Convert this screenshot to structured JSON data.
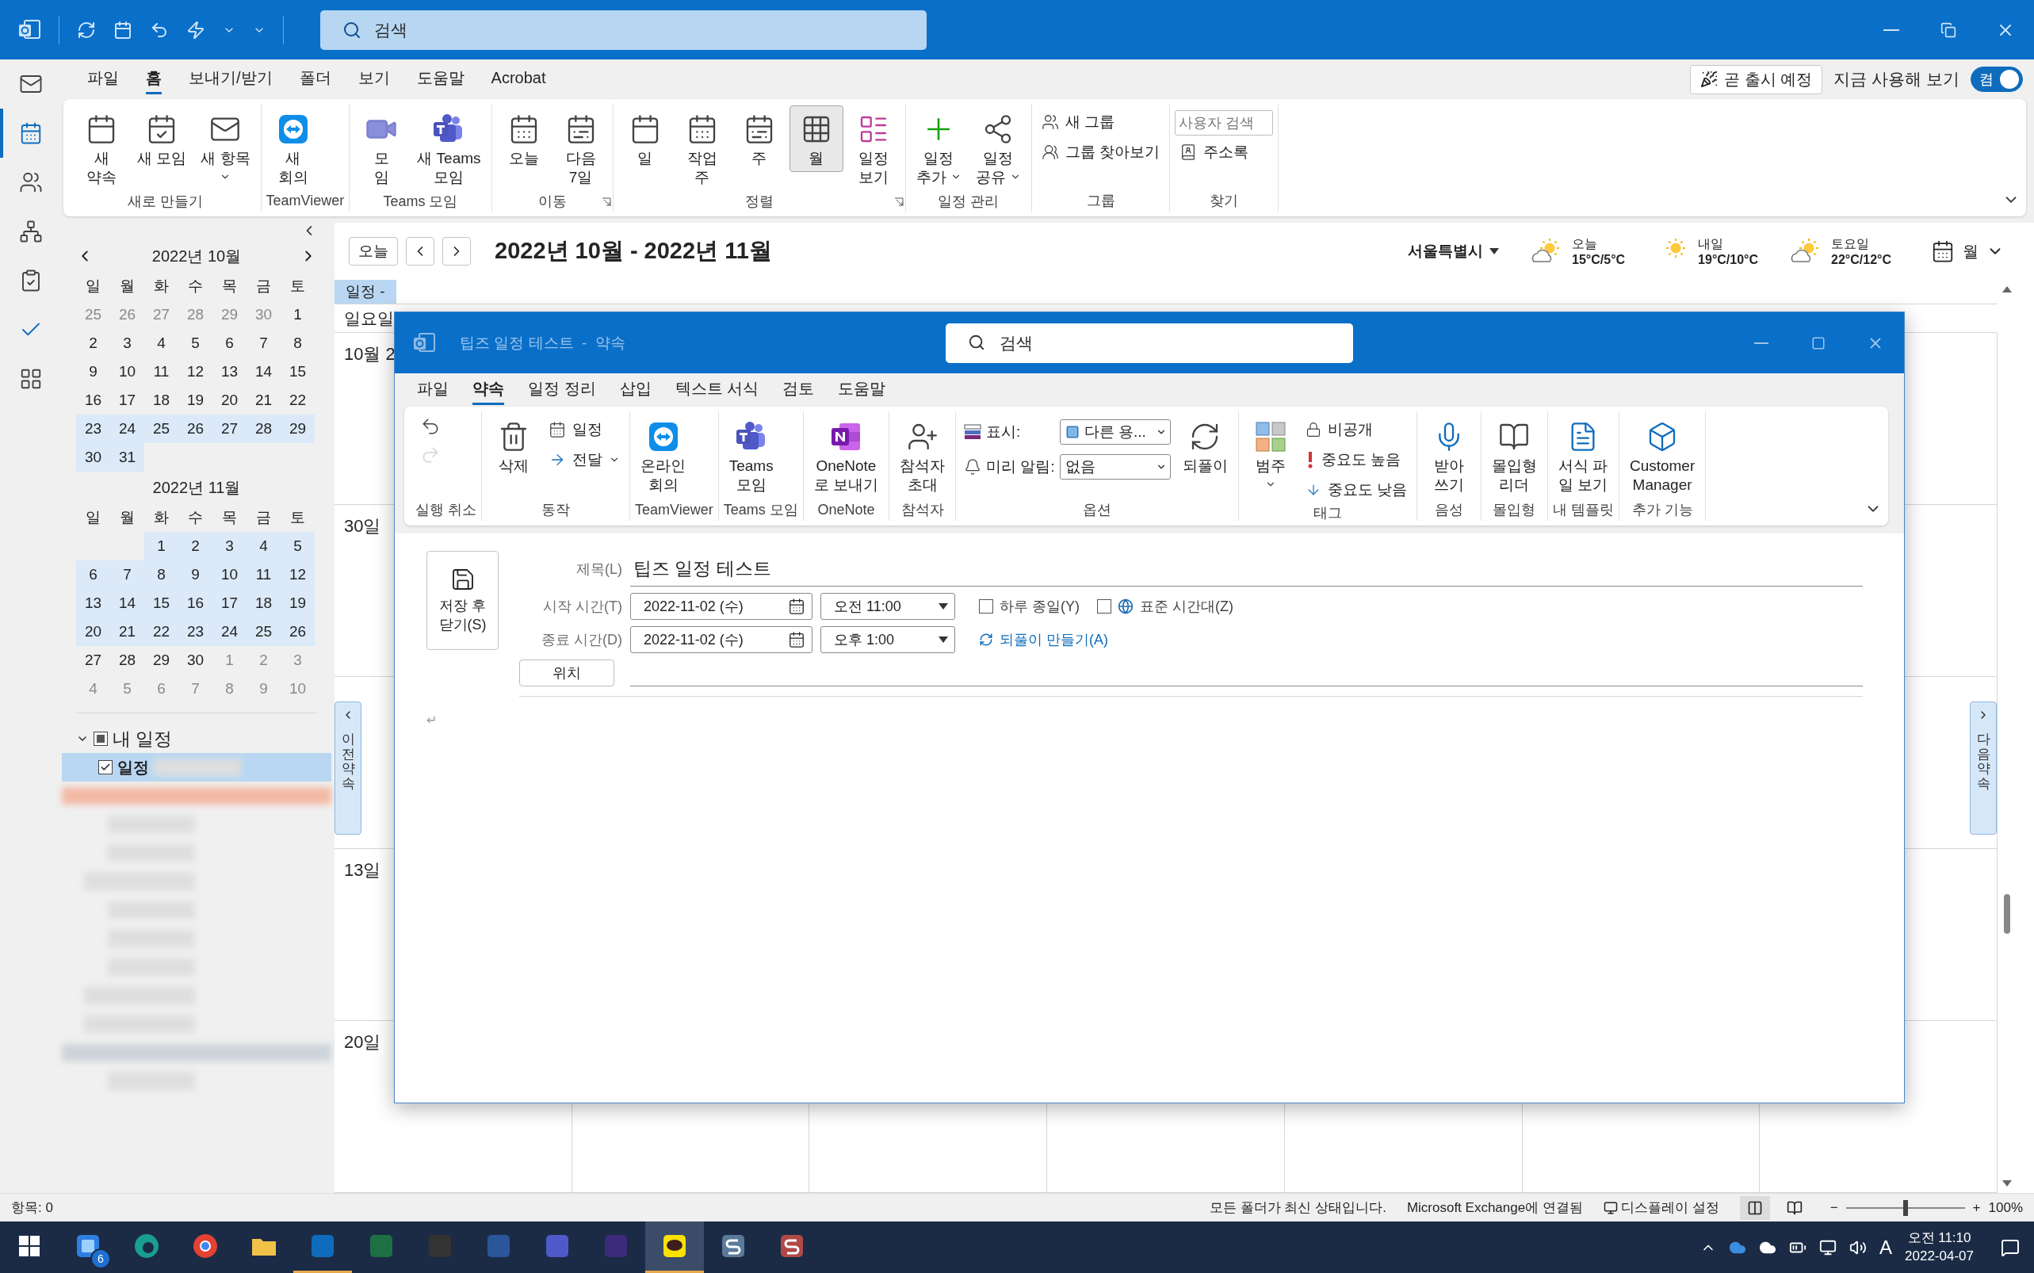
{
  "titlebar": {
    "search": {
      "placeholder": "검색"
    }
  },
  "menu": {
    "tabs": [
      {
        "label": "파일",
        "selected": false
      },
      {
        "label": "홈",
        "selected": true
      },
      {
        "label": "보내기/받기",
        "selected": false
      },
      {
        "label": "폴더",
        "selected": false
      },
      {
        "label": "보기",
        "selected": false
      },
      {
        "label": "도움말",
        "selected": false
      },
      {
        "label": "Acrobat",
        "selected": false
      }
    ],
    "coming_soon": "곧 출시 예정",
    "try_now": "지금 사용해 보기",
    "toggle": {
      "label": "켬",
      "on": true
    }
  },
  "nav": [
    {
      "selected": false
    },
    {
      "selected": true
    },
    {
      "selected": false
    },
    {
      "selected": false
    },
    {
      "selected": false
    },
    {
      "selected": false
    },
    {
      "selected": false
    }
  ],
  "ribbon": {
    "groups": [
      {
        "name": "새로 만들기",
        "items": [
          {
            "kind": "large",
            "label": "새\n약속"
          },
          {
            "kind": "large",
            "label": "새 모임"
          },
          {
            "kind": "large",
            "label": "새 항목",
            "menu": true
          }
        ]
      },
      {
        "name": "TeamViewer",
        "items": [
          {
            "kind": "large",
            "label": "새\n회의"
          }
        ]
      },
      {
        "name": "Teams 모임",
        "items": [
          {
            "kind": "large",
            "label": "모\n임"
          },
          {
            "kind": "large",
            "label": "새 Teams\n모임"
          }
        ]
      },
      {
        "name": "이동",
        "launcher": true,
        "items": [
          {
            "kind": "large",
            "label": "오늘"
          },
          {
            "kind": "large",
            "label": "다음\n7일"
          }
        ]
      },
      {
        "name": "정렬",
        "launcher": true,
        "items": [
          {
            "kind": "large",
            "label": "일",
            "selected": false
          },
          {
            "kind": "large",
            "label": "작업\n주",
            "selected": false
          },
          {
            "kind": "large",
            "label": "주",
            "selected": false
          },
          {
            "kind": "large",
            "label": "월",
            "selected": true
          },
          {
            "kind": "large",
            "label": "일정\n보기",
            "selected": false
          }
        ]
      },
      {
        "name": "일정 관리",
        "items": [
          {
            "kind": "large",
            "label": "일정\n추가",
            "menu": true
          },
          {
            "kind": "large",
            "label": "일정\n공유",
            "menu": true
          }
        ]
      },
      {
        "name": "그룹",
        "items": [
          {
            "kind": "stack",
            "entries": [
              {
                "kind": "small",
                "label": "새 그룹"
              },
              {
                "kind": "small",
                "label": "그룹 찾아보기"
              }
            ]
          }
        ]
      },
      {
        "name": "찾기",
        "items": [
          {
            "kind": "stack",
            "entries": [
              {
                "kind": "field",
                "placeholder": "사용자 검색"
              },
              {
                "kind": "small",
                "label": "주소록"
              }
            ]
          }
        ]
      }
    ]
  },
  "sidebar": {
    "months": [
      {
        "title": "2022년 10월",
        "weekdays": [
          "일",
          "월",
          "화",
          "수",
          "목",
          "금",
          "토"
        ],
        "weeks": [
          [
            {
              "d": "25",
              "muted": true,
              "selected": false
            },
            {
              "d": "26",
              "muted": true,
              "selected": false
            },
            {
              "d": "27",
              "muted": true,
              "selected": false
            },
            {
              "d": "28",
              "muted": true,
              "selected": false
            },
            {
              "d": "29",
              "muted": true,
              "selected": false
            },
            {
              "d": "30",
              "muted": true,
              "selected": false
            },
            {
              "d": "1",
              "muted": false,
              "selected": false
            }
          ],
          [
            {
              "d": "2",
              "muted": false,
              "selected": false
            },
            {
              "d": "3",
              "muted": false,
              "selected": false
            },
            {
              "d": "4",
              "muted": false,
              "selected": false
            },
            {
              "d": "5",
              "muted": false,
              "selected": false
            },
            {
              "d": "6",
              "muted": false,
              "selected": false
            },
            {
              "d": "7",
              "muted": false,
              "selected": false
            },
            {
              "d": "8",
              "muted": false,
              "selected": false
            }
          ],
          [
            {
              "d": "9",
              "muted": false,
              "selected": false
            },
            {
              "d": "10",
              "muted": false,
              "selected": false
            },
            {
              "d": "11",
              "muted": false,
              "selected": false
            },
            {
              "d": "12",
              "muted": false,
              "selected": false
            },
            {
              "d": "13",
              "muted": false,
              "selected": false
            },
            {
              "d": "14",
              "muted": false,
              "selected": false
            },
            {
              "d": "15",
              "muted": false,
              "selected": false
            }
          ],
          [
            {
              "d": "16",
              "muted": false,
              "selected": false
            },
            {
              "d": "17",
              "muted": false,
              "selected": false
            },
            {
              "d": "18",
              "muted": false,
              "selected": false
            },
            {
              "d": "19",
              "muted": false,
              "selected": false
            },
            {
              "d": "20",
              "muted": false,
              "selected": false
            },
            {
              "d": "21",
              "muted": false,
              "selected": false
            },
            {
              "d": "22",
              "muted": false,
              "selected": false
            }
          ],
          [
            {
              "d": "23",
              "muted": false,
              "selected": true
            },
            {
              "d": "24",
              "muted": false,
              "selected": true
            },
            {
              "d": "25",
              "muted": false,
              "selected": true
            },
            {
              "d": "26",
              "muted": false,
              "selected": true
            },
            {
              "d": "27",
              "muted": false,
              "selected": true
            },
            {
              "d": "28",
              "muted": false,
              "selected": true
            },
            {
              "d": "29",
              "muted": false,
              "selected": true
            }
          ],
          [
            {
              "d": "30",
              "muted": false,
              "selected": true
            },
            {
              "d": "31",
              "muted": false,
              "selected": true
            }
          ]
        ]
      },
      {
        "title": "2022년 11월",
        "weekdays": [
          "일",
          "월",
          "화",
          "수",
          "목",
          "금",
          "토"
        ],
        "weeks": [
          [
            {
              "d": "1",
              "muted": false,
              "selected": true
            },
            {
              "d": "2",
              "muted": false,
              "selected": true
            },
            {
              "d": "3",
              "muted": false,
              "selected": true
            },
            {
              "d": "4",
              "muted": false,
              "selected": true
            },
            {
              "d": "5",
              "muted": false,
              "selected": true
            }
          ],
          [
            {
              "d": "6",
              "muted": false,
              "selected": true
            },
            {
              "d": "7",
              "muted": false,
              "selected": true
            },
            {
              "d": "8",
              "muted": false,
              "selected": true
            },
            {
              "d": "9",
              "muted": false,
              "selected": true
            },
            {
              "d": "10",
              "muted": false,
              "selected": true
            },
            {
              "d": "11",
              "muted": false,
              "selected": true
            },
            {
              "d": "12",
              "muted": false,
              "selected": true
            }
          ],
          [
            {
              "d": "13",
              "muted": false,
              "selected": true
            },
            {
              "d": "14",
              "muted": false,
              "selected": true
            },
            {
              "d": "15",
              "muted": false,
              "selected": true
            },
            {
              "d": "16",
              "muted": false,
              "selected": true
            },
            {
              "d": "17",
              "muted": false,
              "selected": true
            },
            {
              "d": "18",
              "muted": false,
              "selected": true
            },
            {
              "d": "19",
              "muted": false,
              "selected": true
            }
          ],
          [
            {
              "d": "20",
              "muted": false,
              "selected": true
            },
            {
              "d": "21",
              "muted": false,
              "selected": true
            },
            {
              "d": "22",
              "muted": false,
              "selected": true
            },
            {
              "d": "23",
              "muted": false,
              "selected": true
            },
            {
              "d": "24",
              "muted": false,
              "selected": true
            },
            {
              "d": "25",
              "muted": false,
              "selected": true
            },
            {
              "d": "26",
              "muted": false,
              "selected": true
            }
          ],
          [
            {
              "d": "27",
              "muted": false,
              "selected": false
            },
            {
              "d": "28",
              "muted": false,
              "selected": false
            },
            {
              "d": "29",
              "muted": false,
              "selected": false
            },
            {
              "d": "30",
              "muted": false,
              "selected": false
            },
            {
              "d": "1",
              "muted": true,
              "selected": false
            },
            {
              "d": "2",
              "muted": true,
              "selected": false
            },
            {
              "d": "3",
              "muted": true,
              "selected": false
            }
          ],
          [
            {
              "d": "4",
              "muted": true,
              "selected": false
            },
            {
              "d": "5",
              "muted": true,
              "selected": false
            },
            {
              "d": "6",
              "muted": true,
              "selected": false
            },
            {
              "d": "7",
              "muted": true,
              "selected": false
            },
            {
              "d": "8",
              "muted": true,
              "selected": false
            },
            {
              "d": "9",
              "muted": true,
              "selected": false
            },
            {
              "d": "10",
              "muted": true,
              "selected": false
            }
          ]
        ]
      }
    ],
    "folders": {
      "label": "내 일정",
      "expanded": true,
      "checked": false,
      "indeterminate": true,
      "children": [
        {
          "label": "일정",
          "checked": true,
          "selected": true
        }
      ]
    },
    "blurred_rows": [
      {
        "kind": "highlight"
      },
      {
        "kind": "item"
      },
      {
        "kind": "item"
      },
      {
        "kind": "heading"
      },
      {
        "kind": "item"
      },
      {
        "kind": "item"
      },
      {
        "kind": "item"
      },
      {
        "kind": "heading"
      },
      {
        "kind": "heading"
      },
      {
        "kind": "selected"
      },
      {
        "kind": "item"
      }
    ]
  },
  "calendar": {
    "today": "오늘",
    "range": "2022년 10월 - 2022년 11월",
    "location": "서울특별시",
    "weather": [
      {
        "kind": "partly-cloudy",
        "day": "오늘",
        "temp": "15°C/5°C"
      },
      {
        "kind": "sunny",
        "day": "내일",
        "temp": "19°C/10°C"
      },
      {
        "kind": "partly-cloudy",
        "day": "토요일",
        "temp": "22°C/12°C"
      }
    ],
    "view": "월",
    "tab": "일정 -",
    "day_header": "일요일",
    "weeks": [
      {
        "kind": "labeled",
        "label": "10월 2"
      },
      {
        "kind": "labeled",
        "label": "30일"
      },
      {
        "kind": "unlabeled"
      },
      {
        "kind": "labeled",
        "label": "13일"
      },
      {
        "kind": "labeled",
        "label": "20일"
      }
    ],
    "prev_tab": "이전 약속",
    "next_tab": "다음 약속"
  },
  "dialog": {
    "title": "팁즈 일정 테스트  -  약속",
    "search": {
      "placeholder": "검색"
    },
    "tabs": [
      {
        "label": "파일",
        "selected": false
      },
      {
        "label": "약속",
        "selected": true
      },
      {
        "label": "일정 정리",
        "selected": false
      },
      {
        "label": "삽입",
        "selected": false
      },
      {
        "label": "텍스트 서식",
        "selected": false
      },
      {
        "label": "검토",
        "selected": false
      },
      {
        "label": "도움말",
        "selected": false
      }
    ],
    "ribbon": {
      "groups": [
        {
          "name": "실행 취소",
          "items": [
            {
              "kind": "icons",
              "buttons": [
                {
                  "disabled": false
                },
                {
                  "disabled": true
                }
              ]
            }
          ]
        },
        {
          "name": "동작",
          "items": [
            {
              "kind": "large",
              "label": "삭제"
            },
            {
              "kind": "stack",
              "entries": [
                {
                  "kind": "small",
                  "label": "일정"
                },
                {
                  "kind": "small",
                  "label": "전달",
                  "menu": true
                }
              ]
            }
          ]
        },
        {
          "name": "TeamViewer",
          "items": [
            {
              "kind": "large",
              "label": "온라인\n회의"
            }
          ]
        },
        {
          "name": "Teams 모임",
          "items": [
            {
              "kind": "large",
              "label": "Teams\n모임"
            }
          ]
        },
        {
          "name": "OneNote",
          "items": [
            {
              "kind": "large",
              "label": "OneNote\n로 보내기"
            }
          ]
        },
        {
          "name": "참석자",
          "items": [
            {
              "kind": "large",
              "label": "참석자\n초대"
            }
          ]
        },
        {
          "name": "옵션",
          "items": [
            {
              "kind": "stack",
              "entries": [
                {
                  "kind": "select",
                  "label": "표시:",
                  "value": "다른 용...",
                  "swatch": true
                },
                {
                  "kind": "select",
                  "label": "미리 알림:",
                  "value": "없음",
                  "swatch": false
                }
              ]
            },
            {
              "kind": "large",
              "label": "되풀이"
            }
          ]
        },
        {
          "name": "태그",
          "items": [
            {
              "kind": "large",
              "label": "범주",
              "menu": true
            },
            {
              "kind": "stack",
              "entries": [
                {
                  "kind": "small",
                  "label": "비공개"
                },
                {
                  "kind": "small",
                  "label": "중요도 높음"
                },
                {
                  "kind": "small",
                  "label": "중요도 낮음"
                }
              ]
            }
          ]
        },
        {
          "name": "음성",
          "items": [
            {
              "kind": "large",
              "label": "받아\n쓰기"
            }
          ]
        },
        {
          "name": "몰입형",
          "items": [
            {
              "kind": "large",
              "label": "몰입형\n리더"
            }
          ]
        },
        {
          "name": "내 템플릿",
          "items": [
            {
              "kind": "large",
              "label": "서식 파\n일 보기"
            }
          ]
        },
        {
          "name": "추가 기능",
          "items": [
            {
              "kind": "large",
              "label": "Customer\nManager"
            }
          ]
        }
      ]
    },
    "form": {
      "save": "저장 후\n닫기(S)",
      "subject": {
        "label": "제목(L)",
        "value": "팁즈 일정 테스트"
      },
      "start": {
        "label": "시작 시간(T)",
        "date": "2022-11-02 (수)",
        "time": "오전 11:00"
      },
      "end": {
        "label": "종료 시간(D)",
        "date": "2022-11-02 (수)",
        "time": "오후 1:00"
      },
      "all_day": {
        "label": "하루 종일(Y)",
        "checked": false
      },
      "time_zone": {
        "label": "표준 시간대(Z)",
        "checked": false
      },
      "recurrence": "되풀이 만들기(A)",
      "location": {
        "button": "위치"
      }
    },
    "body": "↵"
  },
  "status_bar": {
    "items": "항목: 0",
    "sync": "모든 폴더가 최신 상태입니다.",
    "connection": "Microsoft Exchange에 연결됨",
    "display": "디스플레이 설정",
    "views": [
      {
        "selected": true
      },
      {
        "selected": false
      }
    ],
    "zoom": {
      "out": "−",
      "in": "+",
      "level": 0.5,
      "label": "100%"
    }
  },
  "taskbar": {
    "apps": [
      {
        "running": false,
        "focused": false,
        "badge": "6"
      },
      {
        "running": false,
        "focused": false
      },
      {
        "running": false,
        "focused": false
      },
      {
        "running": false,
        "focused": false
      },
      {
        "running": true,
        "focused": false
      },
      {
        "running": false,
        "focused": false
      },
      {
        "running": false,
        "focused": false
      },
      {
        "running": false,
        "focused": false
      },
      {
        "running": false,
        "focused": false
      },
      {
        "running": false,
        "focused": false
      },
      {
        "running": true,
        "focused": true
      },
      {
        "running": false,
        "focused": false
      },
      {
        "running": false,
        "focused": false
      }
    ],
    "ime": "A",
    "clock": {
      "time": "오전 11:10",
      "date": "2022-04-07"
    }
  }
}
